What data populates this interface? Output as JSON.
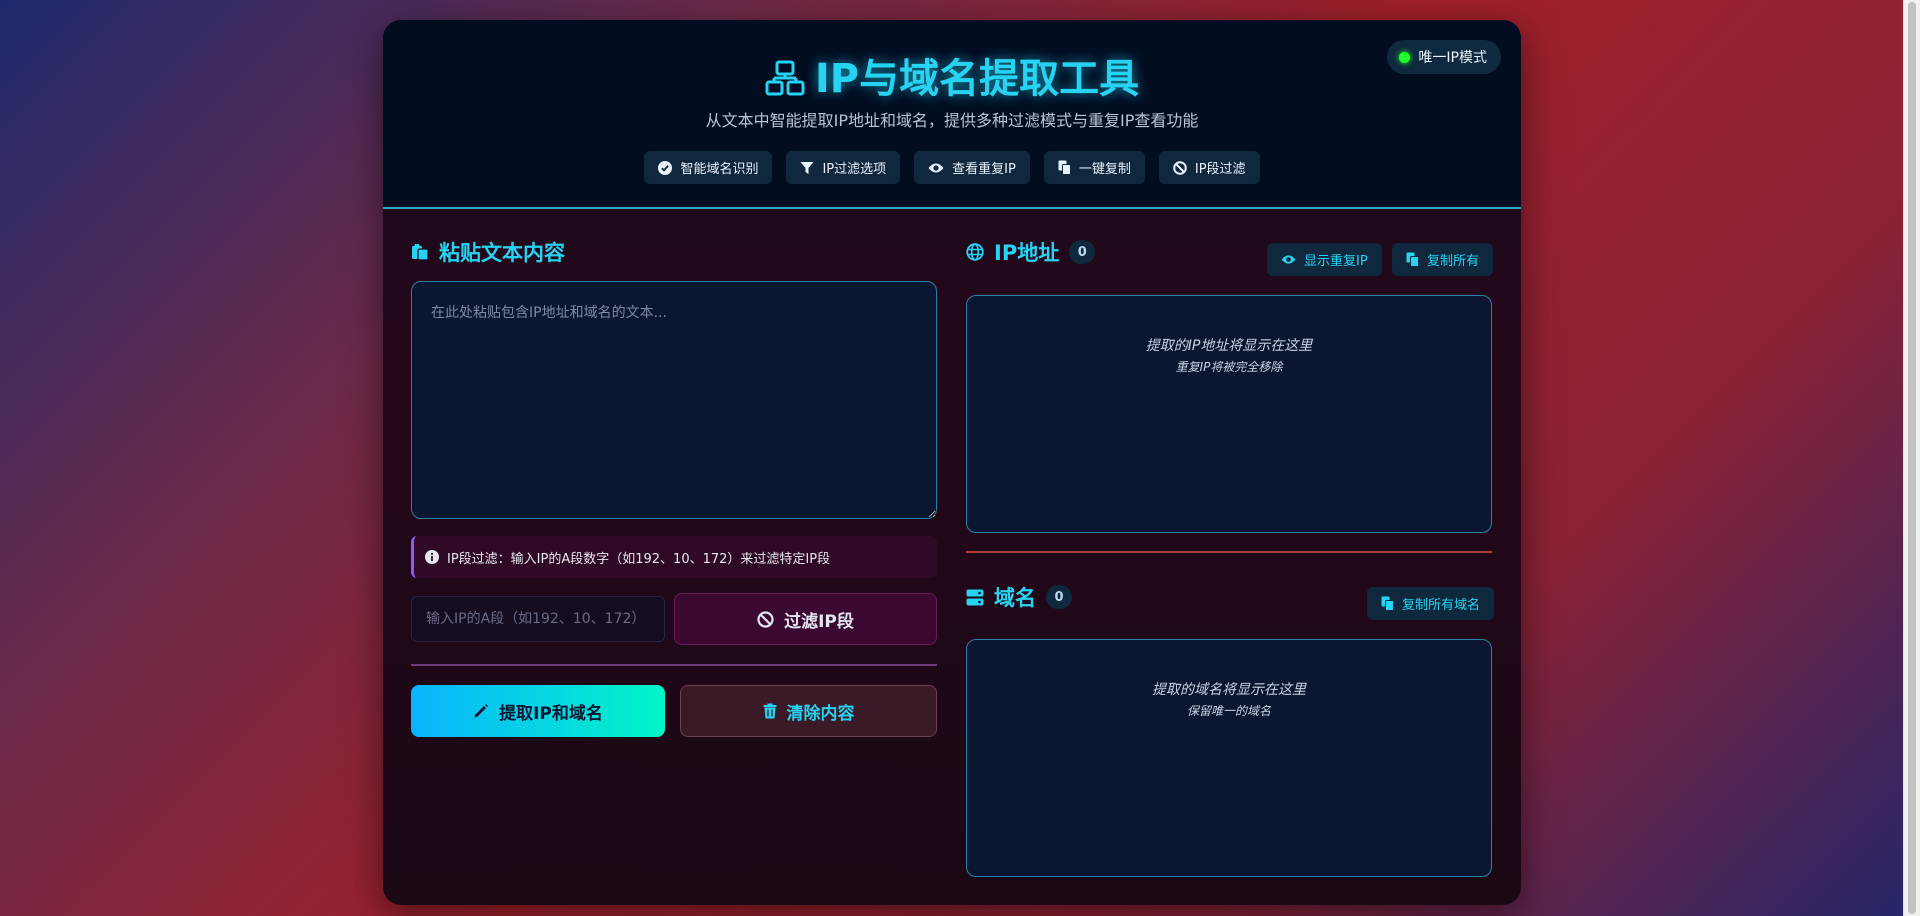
{
  "header": {
    "title": "IP与域名提取工具",
    "subtitle": "从文本中智能提取IP地址和域名，提供多种过滤模式与重复IP查看功能",
    "mode_badge": "唯一IP模式",
    "features": [
      {
        "label": "智能域名识别",
        "icon": "check-circle-icon"
      },
      {
        "label": "IP过滤选项",
        "icon": "filter-icon"
      },
      {
        "label": "查看重复IP",
        "icon": "eye-icon"
      },
      {
        "label": "一键复制",
        "icon": "copy-icon"
      },
      {
        "label": "IP段过滤",
        "icon": "ban-icon"
      }
    ]
  },
  "input_panel": {
    "title": "粘贴文本内容",
    "textarea_placeholder": "在此处粘贴包含IP地址和域名的文本...",
    "info_text": "IP段过滤：输入IP的A段数字（如192、10、172）来过滤特定IP段",
    "filter_placeholder": "输入IP的A段（如192、10、172）",
    "filter_button": "过滤IP段",
    "extract_button": "提取IP和域名",
    "clear_button": "清除内容"
  },
  "ip_panel": {
    "title": "IP地址",
    "count": "0",
    "show_dup_button": "显示重复IP",
    "copy_all_button": "复制所有",
    "empty_main": "提取的IP地址将显示在这里",
    "empty_sub": "重复IP将被完全移除"
  },
  "domain_panel": {
    "title": "域名",
    "count": "0",
    "copy_all_button": "复制所有域名",
    "empty_main": "提取的域名将显示在这里",
    "empty_sub": "保留唯一的域名"
  },
  "colors": {
    "accent": "#27d3f2",
    "status_dot": "#1eff2a",
    "extract_gradient_start": "#0ab4ff",
    "extract_gradient_end": "#00f5c8"
  }
}
